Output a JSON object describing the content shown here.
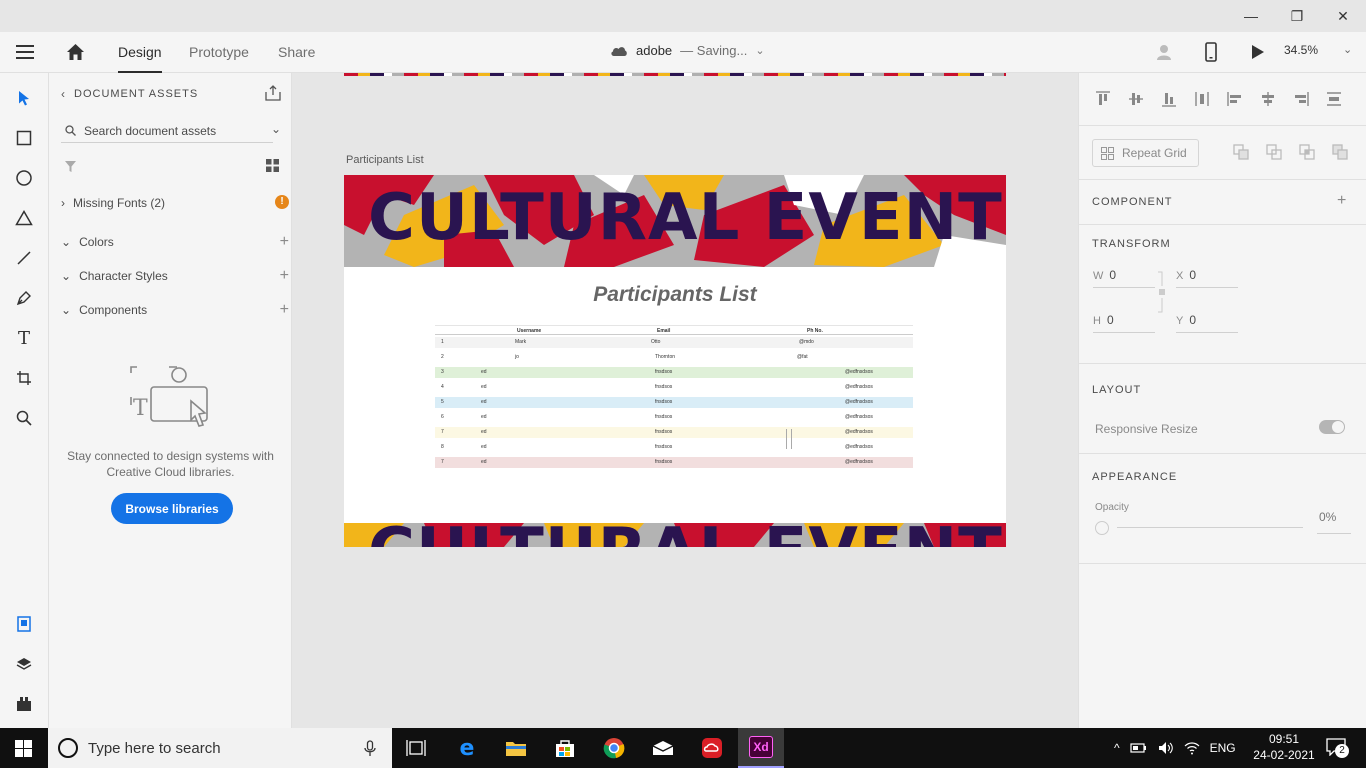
{
  "window": {
    "minimize": "—",
    "restore": "❐",
    "close": "✕"
  },
  "appbar": {
    "tabs": [
      "Design",
      "Prototype",
      "Share"
    ],
    "doc_name": "adobe",
    "doc_status": "— Saving...",
    "zoom": "34.5%"
  },
  "assets": {
    "header": "DOCUMENT ASSETS",
    "search_placeholder": "Search document assets",
    "missing_fonts": "Missing Fonts (2)",
    "sections": [
      "Colors",
      "Character Styles",
      "Components"
    ],
    "lib_text_1": "Stay connected to design systems with",
    "lib_text_2": "Creative Cloud libraries.",
    "browse_button": "Browse libraries"
  },
  "canvas": {
    "artboard_label": "Participants List",
    "banner_text": "CULTURAL EVENT",
    "page_title": "Participants List",
    "table_headers": [
      "Username",
      "Email",
      "Ph No."
    ],
    "rows": [
      {
        "n": "1",
        "a": "Mark",
        "b": "Otto",
        "c": "@mdo",
        "color": "#f3f3f3"
      },
      {
        "n": "2",
        "a": "jo",
        "b": "Thornton",
        "c": "@fat",
        "color": "#ffffff"
      },
      {
        "n": "3",
        "a": "ed",
        "b": "fnsdsos",
        "c": "@edfnsdsos",
        "color": "#dff0d8"
      },
      {
        "n": "4",
        "a": "ed",
        "b": "fnsdsos",
        "c": "@edfnsdsos",
        "color": "#ffffff"
      },
      {
        "n": "5",
        "a": "ed",
        "b": "fnsdsos",
        "c": "@edfnsdsos",
        "color": "#d9edf7"
      },
      {
        "n": "6",
        "a": "ed",
        "b": "fnsdsos",
        "c": "@edfnsdsos",
        "color": "#ffffff"
      },
      {
        "n": "7",
        "a": "ed",
        "b": "fnsdsos",
        "c": "@edfnsdsos",
        "color": "#fcf8e3"
      },
      {
        "n": "8",
        "a": "ed",
        "b": "fnsdsos",
        "c": "@edfnsdsos",
        "color": "#ffffff"
      },
      {
        "n": "7",
        "a": "ed",
        "b": "fnsdsos",
        "c": "@edfnsdsos",
        "color": "#f2dede"
      }
    ]
  },
  "props": {
    "repeat_grid": "Repeat Grid",
    "component": "COMPONENT",
    "transform": "TRANSFORM",
    "w_label": "W",
    "w": "0",
    "x_label": "X",
    "x": "0",
    "h_label": "H",
    "h": "0",
    "y_label": "Y",
    "y": "0",
    "layout": "LAYOUT",
    "responsive": "Responsive Resize",
    "appearance": "APPEARANCE",
    "opacity_label": "Opacity",
    "opacity": "0%"
  },
  "taskbar": {
    "search_placeholder": "Type here to search",
    "lang": "ENG",
    "time": "09:51",
    "date": "24-02-2021",
    "notif": "2",
    "xd_label": "Xd"
  }
}
